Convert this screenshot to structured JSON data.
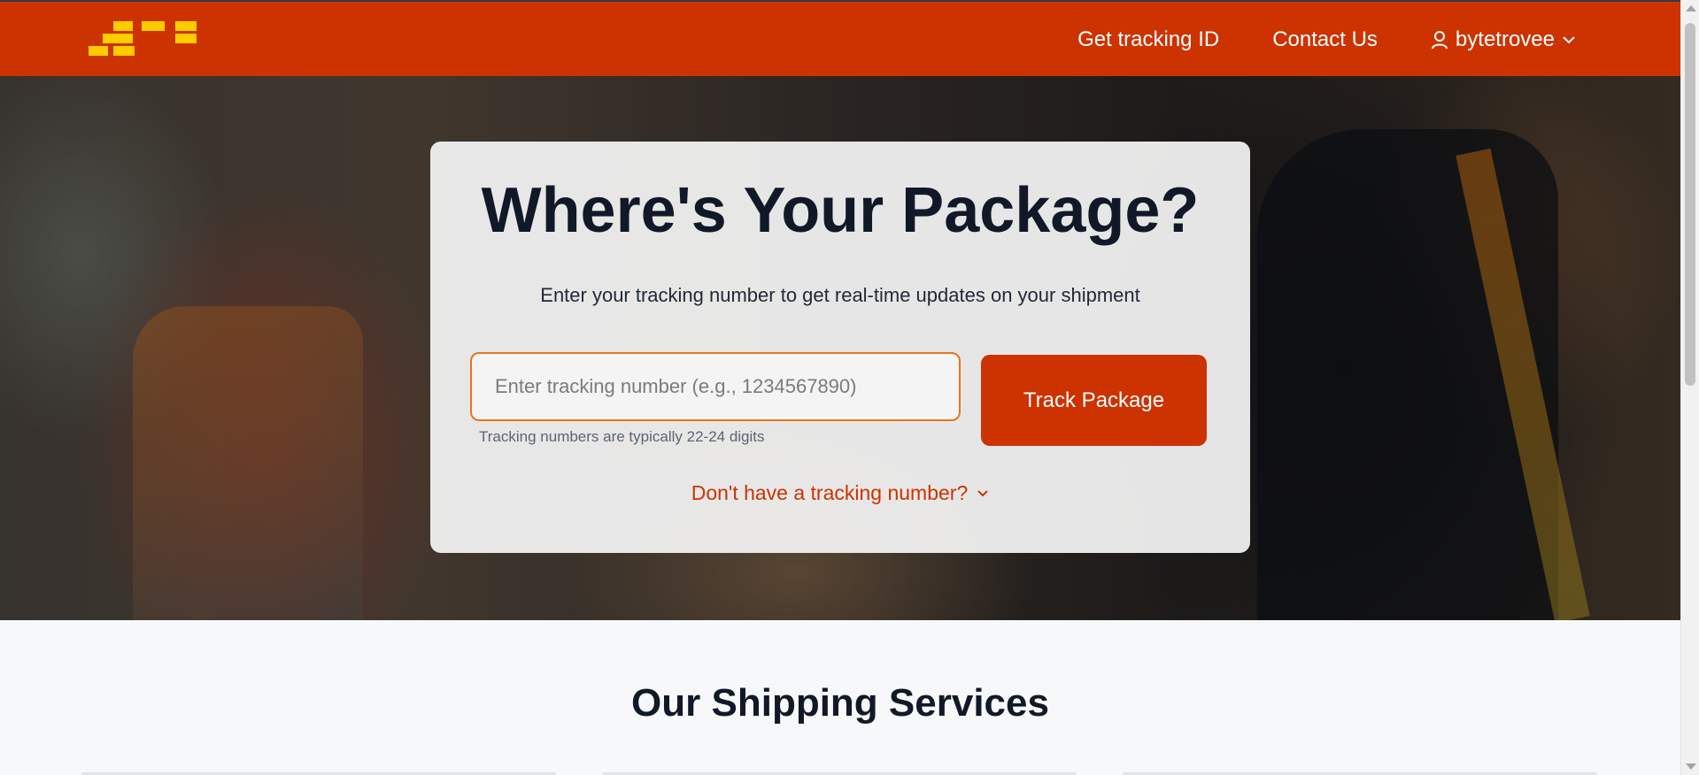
{
  "header": {
    "logo_name": "brand-logo",
    "nav": {
      "get_tracking_id": "Get tracking ID",
      "contact_us": "Contact Us",
      "username": "bytetrovee"
    }
  },
  "hero": {
    "title": "Where's Your Package?",
    "subtitle": "Enter your tracking number to get real-time updates on your shipment",
    "input_placeholder": "Enter tracking number (e.g., 1234567890)",
    "input_value": "",
    "hint": "Tracking numbers are typically 22-24 digits",
    "track_button": "Track Package",
    "no_tracking_link": "Don't have a tracking number?"
  },
  "services": {
    "title": "Our Shipping Services"
  },
  "colors": {
    "brand": "#cc3300",
    "logo_yellow": "#ffcc00",
    "input_focus": "#e8731f",
    "heading": "#111827"
  }
}
